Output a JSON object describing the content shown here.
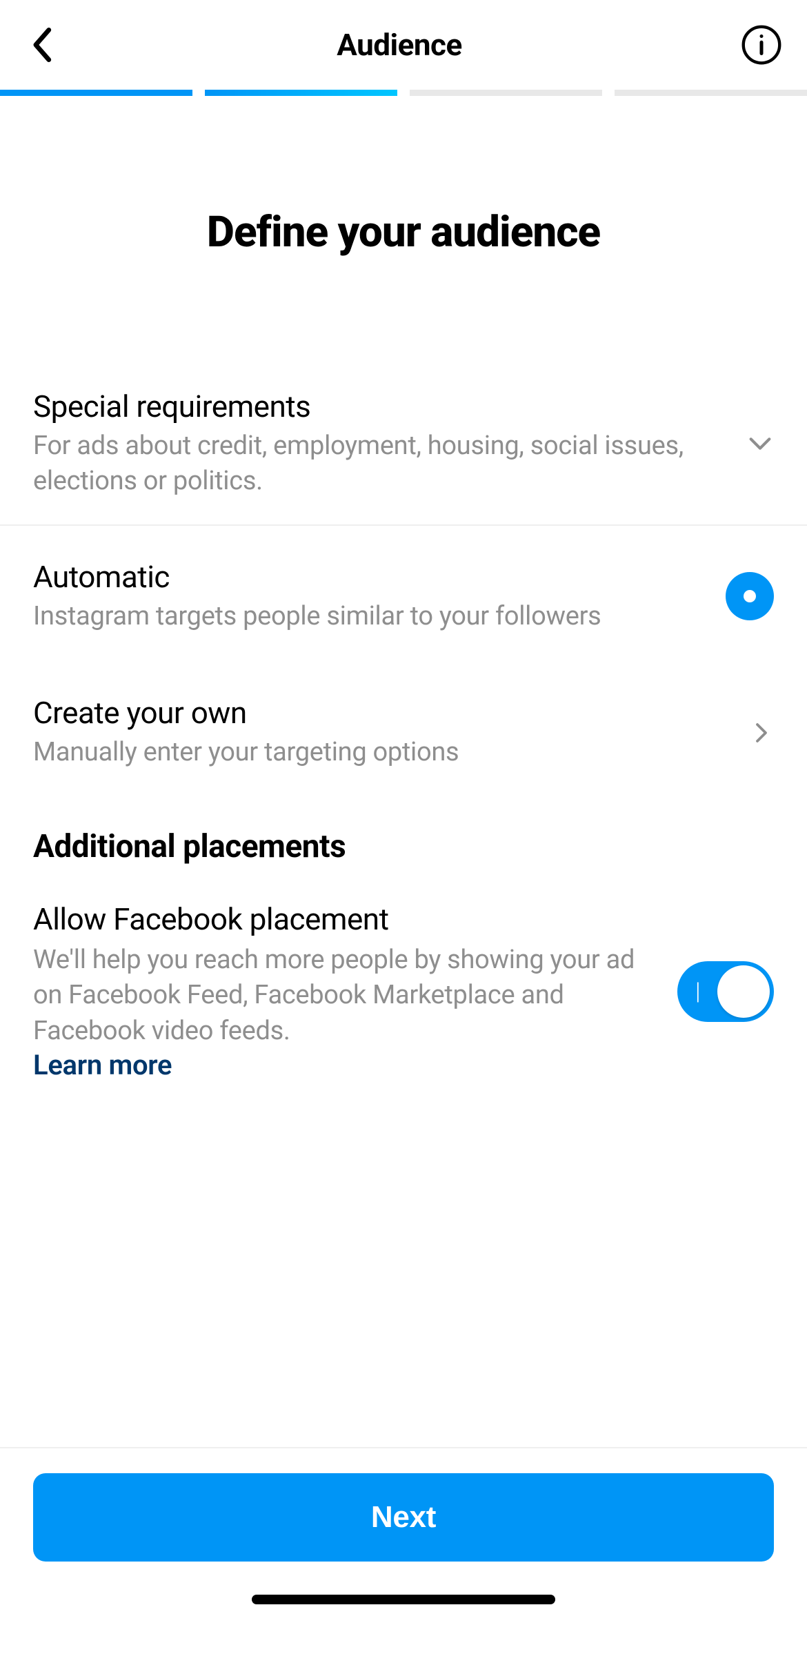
{
  "header": {
    "title": "Audience"
  },
  "page": {
    "heading": "Define your audience"
  },
  "special": {
    "title": "Special requirements",
    "subtitle": "For ads about credit, employment, housing, social issues, elections or politics."
  },
  "options": {
    "automatic": {
      "title": "Automatic",
      "subtitle": "Instagram targets people similar to your followers",
      "selected": true
    },
    "create_own": {
      "title": "Create your own",
      "subtitle": "Manually enter your targeting options"
    }
  },
  "placements": {
    "heading": "Additional placements",
    "facebook": {
      "title": "Allow Facebook placement",
      "subtitle": "We'll help you reach more people by showing your ad on Facebook Feed, Facebook Marketplace and Facebook video feeds.",
      "learn_more": "Learn more",
      "enabled": true
    }
  },
  "footer": {
    "next": "Next"
  }
}
